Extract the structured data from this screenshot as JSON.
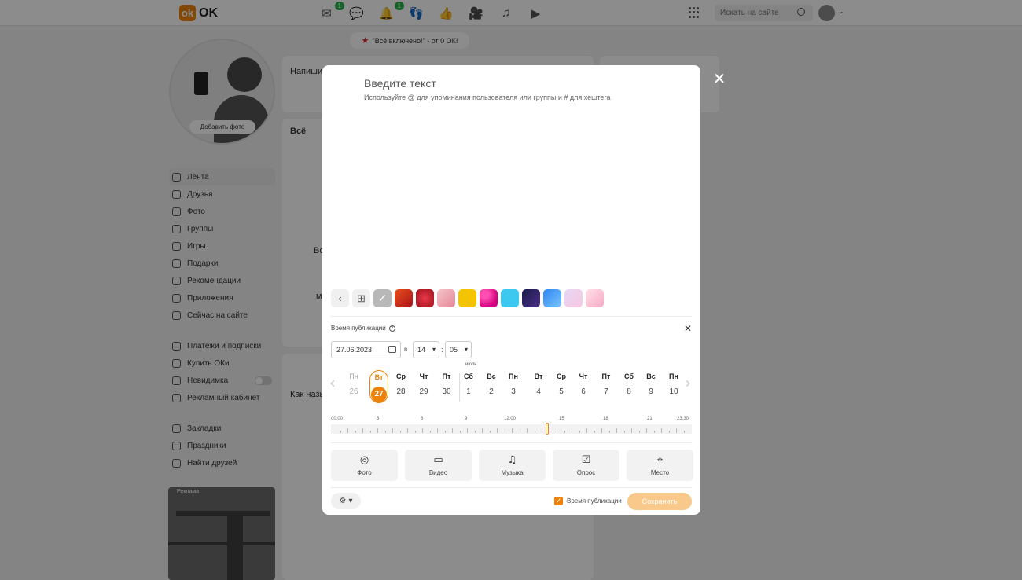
{
  "topbar": {
    "logo_text": "OK",
    "search_placeholder": "Искать на сайте",
    "messages_badge": "1",
    "notifications_badge": "1"
  },
  "promo": {
    "text": "\"Всё включено!\" - от 0 ОК!"
  },
  "profile": {
    "add_photo": "Добавить фото"
  },
  "left_menu": {
    "group1": [
      "Лента",
      "Друзья",
      "Фото",
      "Группы",
      "Игры",
      "Подарки",
      "Рекомендации",
      "Приложения",
      "Сейчас на сайте"
    ],
    "group2": [
      "Платежи и подписки",
      "Купить ОКи",
      "Невидимка",
      "Рекламный кабинет"
    ],
    "group3": [
      "Закладки",
      "Праздники",
      "Найти друзей"
    ]
  },
  "ad": {
    "label": "Реклама"
  },
  "feed": {
    "compose_text": "Напиши",
    "filter_all": "Всё",
    "post_snippet": "Как назы",
    "side_text_1": "Во",
    "side_text_2": "м"
  },
  "modal": {
    "title": "Введите текст",
    "hint": "Используйте @ для упоминания пользователя или группы и # для хештега",
    "publish_time_label": "Время публикации",
    "date_value": "27.06.2023",
    "at_label": "в",
    "hour_value": "14",
    "minute_value": "05",
    "month_label": "июль",
    "days": [
      {
        "dow": "Пн",
        "num": "26"
      },
      {
        "dow": "Вт",
        "num": "27"
      },
      {
        "dow": "Ср",
        "num": "28"
      },
      {
        "dow": "Чт",
        "num": "29"
      },
      {
        "dow": "Пт",
        "num": "30"
      },
      {
        "dow": "Сб",
        "num": "1"
      },
      {
        "dow": "Вс",
        "num": "2"
      },
      {
        "dow": "Пн",
        "num": "3"
      },
      {
        "dow": "Вт",
        "num": "4"
      },
      {
        "dow": "Ср",
        "num": "5"
      },
      {
        "dow": "Чт",
        "num": "6"
      },
      {
        "dow": "Пт",
        "num": "7"
      },
      {
        "dow": "Сб",
        "num": "8"
      },
      {
        "dow": "Вс",
        "num": "9"
      },
      {
        "dow": "Пн",
        "num": "10"
      }
    ],
    "timeline_labels": [
      "00:00",
      "3",
      "6",
      "9",
      "12:00",
      "15",
      "18",
      "21",
      "23:30"
    ],
    "attachments": [
      {
        "icon": "camera-icon",
        "label": "Фото"
      },
      {
        "icon": "video-icon",
        "label": "Видео"
      },
      {
        "icon": "music-icon",
        "label": "Музыка"
      },
      {
        "icon": "poll-icon",
        "label": "Опрос"
      },
      {
        "icon": "location-icon",
        "label": "Место"
      }
    ],
    "checkbox_label": "Время публикации",
    "save_label": "Сохранить"
  },
  "colors": {
    "accent": "#ee8208",
    "save_disabled": "#f8c98a",
    "badge_green": "#2bb24c"
  }
}
